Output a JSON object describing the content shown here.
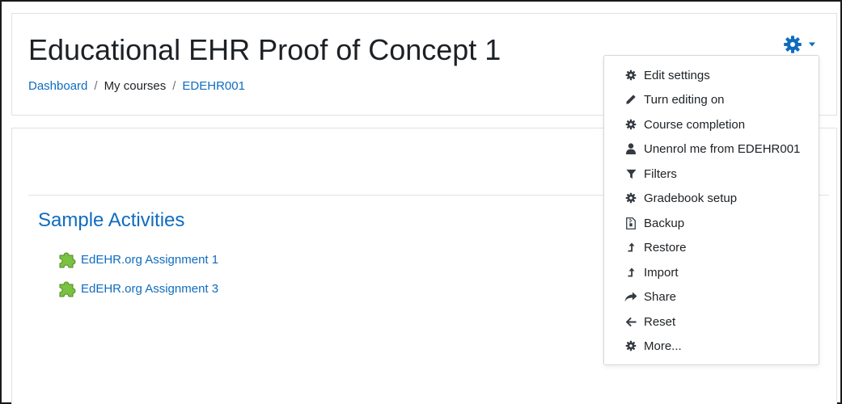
{
  "header": {
    "title": "Educational EHR Proof of Concept 1",
    "breadcrumb": [
      {
        "label": "Dashboard",
        "link": true
      },
      {
        "label": "My courses",
        "link": false
      },
      {
        "label": "EDEHR001",
        "link": true
      }
    ],
    "breadcrumb_separator": "/"
  },
  "actions_menu": {
    "toggle_icon": "gear-icon",
    "caret_icon": "caret-down-icon",
    "accent_color": "#0f6cbf",
    "items": [
      {
        "label": "Edit settings",
        "icon": "gear-icon"
      },
      {
        "label": "Turn editing on",
        "icon": "pencil-icon"
      },
      {
        "label": "Course completion",
        "icon": "gear-icon"
      },
      {
        "label": "Unenrol me from EDEHR001",
        "icon": "user-icon"
      },
      {
        "label": "Filters",
        "icon": "filter-icon"
      },
      {
        "label": "Gradebook setup",
        "icon": "gear-icon"
      },
      {
        "label": "Backup",
        "icon": "file-archive-icon"
      },
      {
        "label": "Restore",
        "icon": "level-up-icon"
      },
      {
        "label": "Import",
        "icon": "level-up-icon"
      },
      {
        "label": "Share",
        "icon": "share-icon"
      },
      {
        "label": "Reset",
        "icon": "arrow-left-icon"
      },
      {
        "label": "More...",
        "icon": "gear-icon"
      }
    ]
  },
  "section": {
    "title": "Sample Activities",
    "activities": [
      {
        "label": "EdEHR.org Assignment 1",
        "icon": "puzzle-piece-icon"
      },
      {
        "label": "EdEHR.org Assignment 3",
        "icon": "puzzle-piece-icon"
      }
    ]
  }
}
